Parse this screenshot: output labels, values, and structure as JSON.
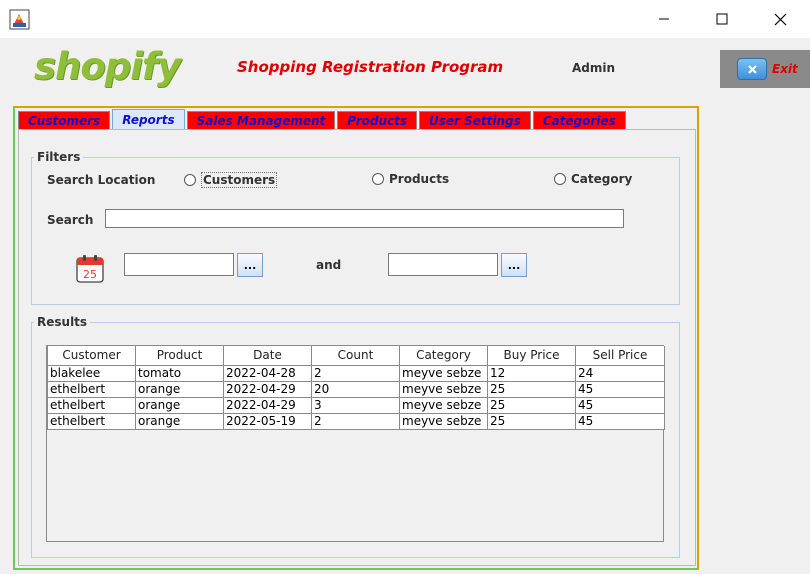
{
  "window": {
    "icon": "java-app-icon",
    "controls": [
      "minimize-icon",
      "maximize-icon",
      "close-icon"
    ]
  },
  "header": {
    "logo": "shopify",
    "title": "Shopping Registration Program",
    "user": "Admin",
    "exit_label": "Exit",
    "exit_icon": "close-x-icon",
    "colors": {
      "title": "#e00000",
      "logo": "#8fbf3a",
      "tab_bg": "#ff0000",
      "tab_text": "#1010c8"
    }
  },
  "tabs": [
    {
      "label": "Customers",
      "active": false
    },
    {
      "label": "Reports",
      "active": true
    },
    {
      "label": "Sales Management",
      "active": false
    },
    {
      "label": "Products",
      "active": false
    },
    {
      "label": "User Settings",
      "active": false
    },
    {
      "label": "Categories",
      "active": false
    }
  ],
  "filters": {
    "title": "Filters",
    "search_location_label": "Search Location",
    "options": [
      "Customers",
      "Products",
      "Category"
    ],
    "search_label": "Search",
    "search_value": "",
    "date_from": "",
    "date_to": "",
    "and_label": "and",
    "picker_label": "...",
    "calendar_day": "25"
  },
  "results": {
    "title": "Results",
    "columns": [
      "Customer",
      "Product",
      "Date",
      "Count",
      "Category",
      "Buy Price",
      "Sell Price"
    ],
    "rows": [
      [
        "blakelee",
        "tomato",
        "2022-04-28",
        "2",
        "meyve sebze",
        "12",
        "24"
      ],
      [
        "ethelbert",
        "orange",
        "2022-04-29",
        "20",
        "meyve sebze",
        "25",
        "45"
      ],
      [
        "ethelbert",
        "orange",
        "2022-04-29",
        "3",
        "meyve sebze",
        "25",
        "45"
      ],
      [
        "ethelbert",
        "orange",
        "2022-05-19",
        "2",
        "meyve sebze",
        "25",
        "45"
      ]
    ]
  }
}
